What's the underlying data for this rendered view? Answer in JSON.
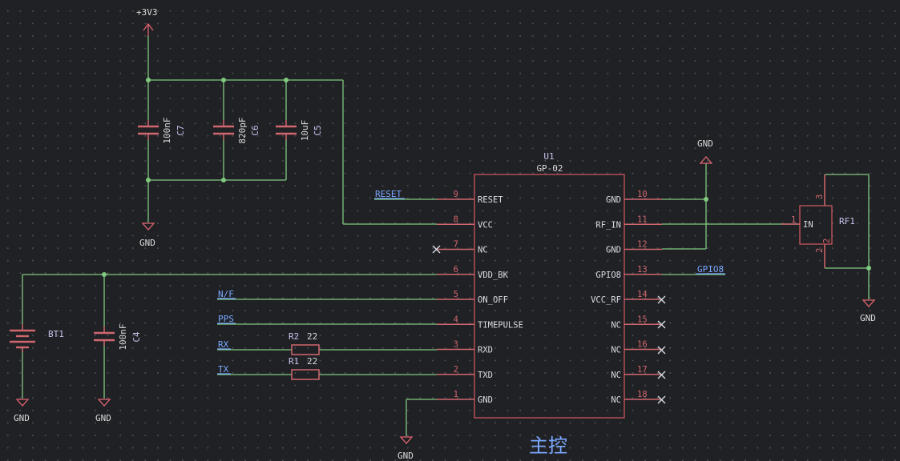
{
  "power": {
    "supply": "+3V3",
    "ground": "GND"
  },
  "caps": {
    "c7": {
      "ref": "C7",
      "value": "100nF"
    },
    "c6": {
      "ref": "C6",
      "value": "820pF"
    },
    "c5": {
      "ref": "C5",
      "value": "10uF"
    },
    "c4": {
      "ref": "C4",
      "value": "100nF"
    }
  },
  "module": {
    "ref": "U1",
    "value": "GP-02",
    "left_pins": [
      {
        "num": "9",
        "name": "RESET"
      },
      {
        "num": "8",
        "name": "VCC"
      },
      {
        "num": "7",
        "name": "NC"
      },
      {
        "num": "6",
        "name": "VDD_BK"
      },
      {
        "num": "5",
        "name": "ON_OFF"
      },
      {
        "num": "4",
        "name": "TIMEPULSE"
      },
      {
        "num": "3",
        "name": "RXD"
      },
      {
        "num": "2",
        "name": "TXD"
      },
      {
        "num": "1",
        "name": "GND"
      }
    ],
    "right_pins": [
      {
        "num": "10",
        "name": "GND"
      },
      {
        "num": "11",
        "name": "RF_IN"
      },
      {
        "num": "12",
        "name": "GND"
      },
      {
        "num": "13",
        "name": "GPIO8"
      },
      {
        "num": "14",
        "name": "VCC_RF"
      },
      {
        "num": "15",
        "name": "NC"
      },
      {
        "num": "16",
        "name": "NC"
      },
      {
        "num": "17",
        "name": "NC"
      },
      {
        "num": "18",
        "name": "NC"
      }
    ]
  },
  "nets": {
    "reset": "RESET",
    "nf": "N/F",
    "pps": "PPS",
    "rx": "RX",
    "tx": "TX",
    "gpio8": "GPIO8"
  },
  "resistors": {
    "r2": {
      "ref": "R2",
      "value": "22"
    },
    "r1": {
      "ref": "R1",
      "value": "22"
    }
  },
  "battery": {
    "ref": "BT1"
  },
  "rf": {
    "ref": "RF1",
    "pin1_num": "1",
    "pin1_name": "IN",
    "pin2_num": "2",
    "pin3_num": "3"
  },
  "sheet_title": "主控"
}
